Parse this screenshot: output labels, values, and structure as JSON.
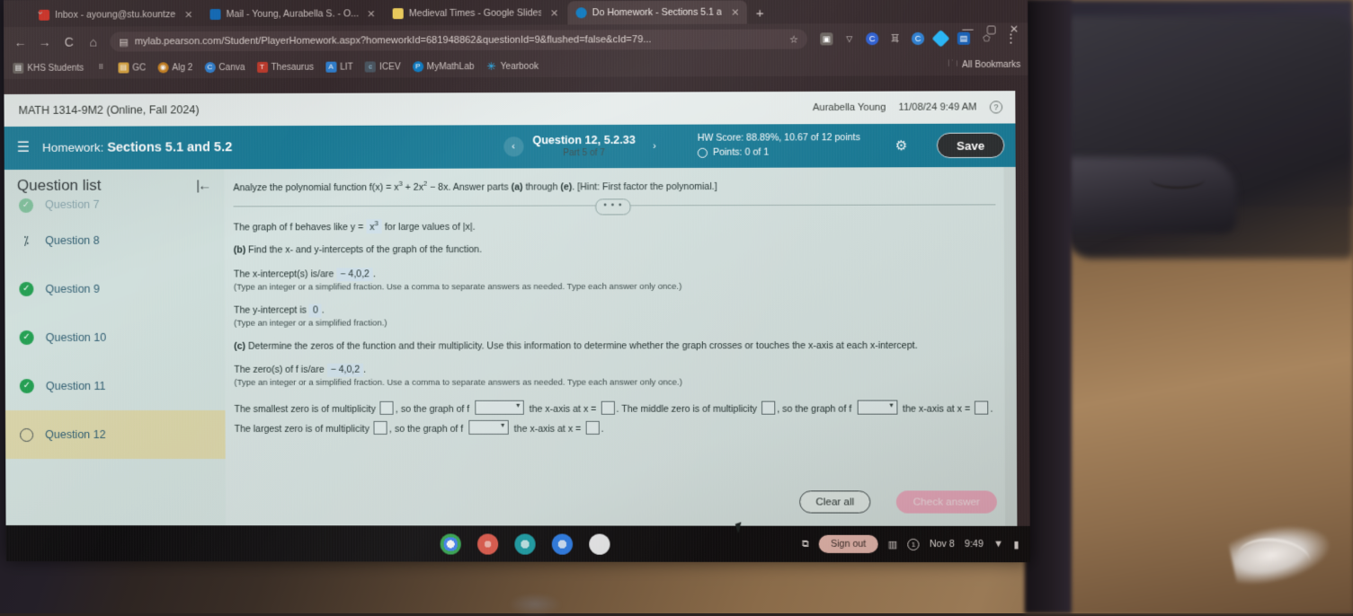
{
  "browser": {
    "tabs": [
      {
        "label": "Inbox - ayoung@stu.kountze",
        "favicon": "gmail-icon",
        "color": "#d93025",
        "active": false
      },
      {
        "label": "Mail - Young, Aurabella S. - O...",
        "favicon": "outlook-icon",
        "color": "#0f6cbd",
        "active": false
      },
      {
        "label": "Medieval Times - Google Slides",
        "favicon": "slides-icon",
        "color": "#f4b400",
        "active": false
      },
      {
        "label": "Do Homework - Sections 5.1 a",
        "favicon": "pearson-icon",
        "color": "#0d7cc4",
        "active": true
      }
    ],
    "new_tab_label": "+",
    "nav": {
      "back": "←",
      "forward": "→",
      "reload": "C",
      "home": "⌂"
    },
    "url": "mylab.pearson.com/Student/PlayerHomework.aspx?homeworkId=681948862&questionId=9&flushed=false&cId=79...",
    "star": "☆",
    "window_controls": {
      "minimize": "—",
      "maximize": "▢",
      "close": "✕"
    },
    "extensions": [
      {
        "name": "screenshot-extension-icon",
        "color": "#6b6460",
        "glyph": "▣"
      },
      {
        "name": "shield-extension-icon",
        "color": "#5d6b6a",
        "glyph": "▽"
      },
      {
        "name": "c-extension-icon",
        "color": "#2f5fd0",
        "glyph": "C"
      },
      {
        "name": "grammarly-extension-icon",
        "color": "#4a5560",
        "glyph": "耳"
      },
      {
        "name": "c2-extension-icon",
        "color": "#2f7fd0",
        "glyph": "C"
      },
      {
        "name": "diamond-extension-icon",
        "color": "#29b6f6",
        "glyph": "◆"
      },
      {
        "name": "office-extension-icon",
        "color": "#1a61b5",
        "glyph": "▤"
      },
      {
        "name": "pentagon-extension-icon",
        "color": "#5c5450",
        "glyph": "⬠"
      }
    ],
    "menu_glyph": "⋮",
    "bookmarks": [
      {
        "label": "KHS Students",
        "color": "#6b6460",
        "glyph": "▤"
      },
      {
        "label": "",
        "color": "#6b6460",
        "glyph": "⠿"
      },
      {
        "label": "GC",
        "color": "#d9a33d",
        "glyph": "▤"
      },
      {
        "label": "Alg 2",
        "color": "#c9811f",
        "glyph": "◉"
      },
      {
        "label": "Canva",
        "color": "#2f7fd0",
        "glyph": "C"
      },
      {
        "label": "Thesaurus",
        "color": "#c0392b",
        "glyph": "T"
      },
      {
        "label": "LIT",
        "color": "#2f7fd0",
        "glyph": "A"
      },
      {
        "label": "ICEV",
        "color": "#4a5560",
        "glyph": "c"
      },
      {
        "label": "MyMathLab",
        "color": "#0d7cc4",
        "glyph": "P"
      },
      {
        "label": "Yearbook",
        "color": "#29b6f6",
        "glyph": "✳"
      }
    ],
    "all_bookmarks_label": "All Bookmarks",
    "all_bookmarks_icon": "folder-icon"
  },
  "course": {
    "title": "MATH 1314-9M2 (Online, Fall 2024)",
    "student_name": "Aurabella Young",
    "timestamp": "11/08/24 9:49 AM",
    "help_glyph": "?"
  },
  "homework_bar": {
    "menu_glyph": "☰",
    "label": "Homework:",
    "title": "Sections 5.1 and 5.2",
    "prev_glyph": "‹",
    "next_glyph": "›",
    "question_label": "Question 12, 5.2.33",
    "part_label": "Part 5 of 7",
    "hw_score": "HW Score: 88.89%, 10.67 of 12 points",
    "points": "Points: 0 of 1",
    "gear_glyph": "⚙",
    "save_label": "Save",
    "accent_color": "#197a96"
  },
  "sidebar": {
    "title": "Question list",
    "collapse_glyph": "|←",
    "items": [
      {
        "label": "Question 7",
        "status": "check",
        "current": false,
        "cut": true
      },
      {
        "label": "Question 8",
        "status": "partial",
        "current": false,
        "cut": false
      },
      {
        "label": "Question 9",
        "status": "check",
        "current": false,
        "cut": false
      },
      {
        "label": "Question 10",
        "status": "check",
        "current": false,
        "cut": false
      },
      {
        "label": "Question 11",
        "status": "check",
        "current": false,
        "cut": false
      },
      {
        "label": "Question 12",
        "status": "open",
        "current": true,
        "cut": false
      }
    ],
    "highlight_color": "#d9d4a8"
  },
  "question": {
    "prompt_1": "Analyze the polynomial function f(x) = x",
    "prompt_exp1": "3",
    "prompt_2": " + 2x",
    "prompt_exp2": "2",
    "prompt_3": " − 8x. Answer parts ",
    "prompt_a": "(a)",
    "prompt_4": " through ",
    "prompt_e": "(e)",
    "prompt_5": ". [Hint: First factor the polynomial.]",
    "dots_glyph": "• • •",
    "behaves_1": "The graph of f behaves like y = ",
    "behaves_answer": "x",
    "behaves_exp": "3",
    "behaves_2": " for large values of |x|.",
    "part_b_label": "(b)",
    "part_b_text": " Find the x- and y-intercepts of the graph of the function.",
    "x_intercept_label": "The x-intercept(s) is/are ",
    "x_intercept_value": "− 4,0,2",
    "x_intercept_hint": "(Type an integer or a simplified fraction. Use a comma to separate answers as needed. Type each answer only once.)",
    "y_intercept_label": "The y-intercept is ",
    "y_intercept_value": "0",
    "y_intercept_hint": "(Type an integer or a simplified fraction.)",
    "part_c_label": "(c)",
    "part_c_text": " Determine the zeros of the function and their multiplicity. Use this information to determine whether the graph crosses or touches the x-axis at each x-intercept.",
    "zeros_label": "The zero(s) of f is/are ",
    "zeros_value": "− 4,0,2",
    "zeros_hint": "(Type an integer or a simplified fraction. Use a comma to separate answers as needed. Type each answer only once.)",
    "smallest_1": "The smallest zero is of multiplicity ",
    "smallest_2": ", so the graph of f ",
    "smallest_3": " the x-axis at x = ",
    "smallest_4": ". The middle zero is of multiplicity ",
    "middle_2": ", so the graph of f ",
    "middle_3": " the x-axis at x = ",
    "middle_4": ". The",
    "largest_1": "largest zero is of multiplicity ",
    "largest_2": ", so the graph of f ",
    "largest_3": " the x-axis at x = ",
    "largest_4": ".",
    "dropdown_value": "",
    "dropdown_caret": "▼",
    "clear_all_label": "Clear all",
    "check_answer_label": "Check answer"
  },
  "shelf": {
    "apps": [
      {
        "name": "chrome-app-icon",
        "color": "#4285f4"
      },
      {
        "name": "paint-app-icon",
        "color": "#e05a4c"
      },
      {
        "name": "slides-app-icon",
        "color": "#1aa0a8"
      },
      {
        "name": "docs-app-icon",
        "color": "#2b7de9"
      },
      {
        "name": "play-store-app-icon",
        "color": "#ffffff"
      }
    ],
    "screenshot_glyph": "⧉",
    "sign_out_label": "Sign out",
    "status_glyph": "▥",
    "notification_glyph": "1",
    "date": "Nov 8",
    "time": "9:49",
    "wifi_glyph": "▼",
    "battery_glyph": "▮"
  }
}
